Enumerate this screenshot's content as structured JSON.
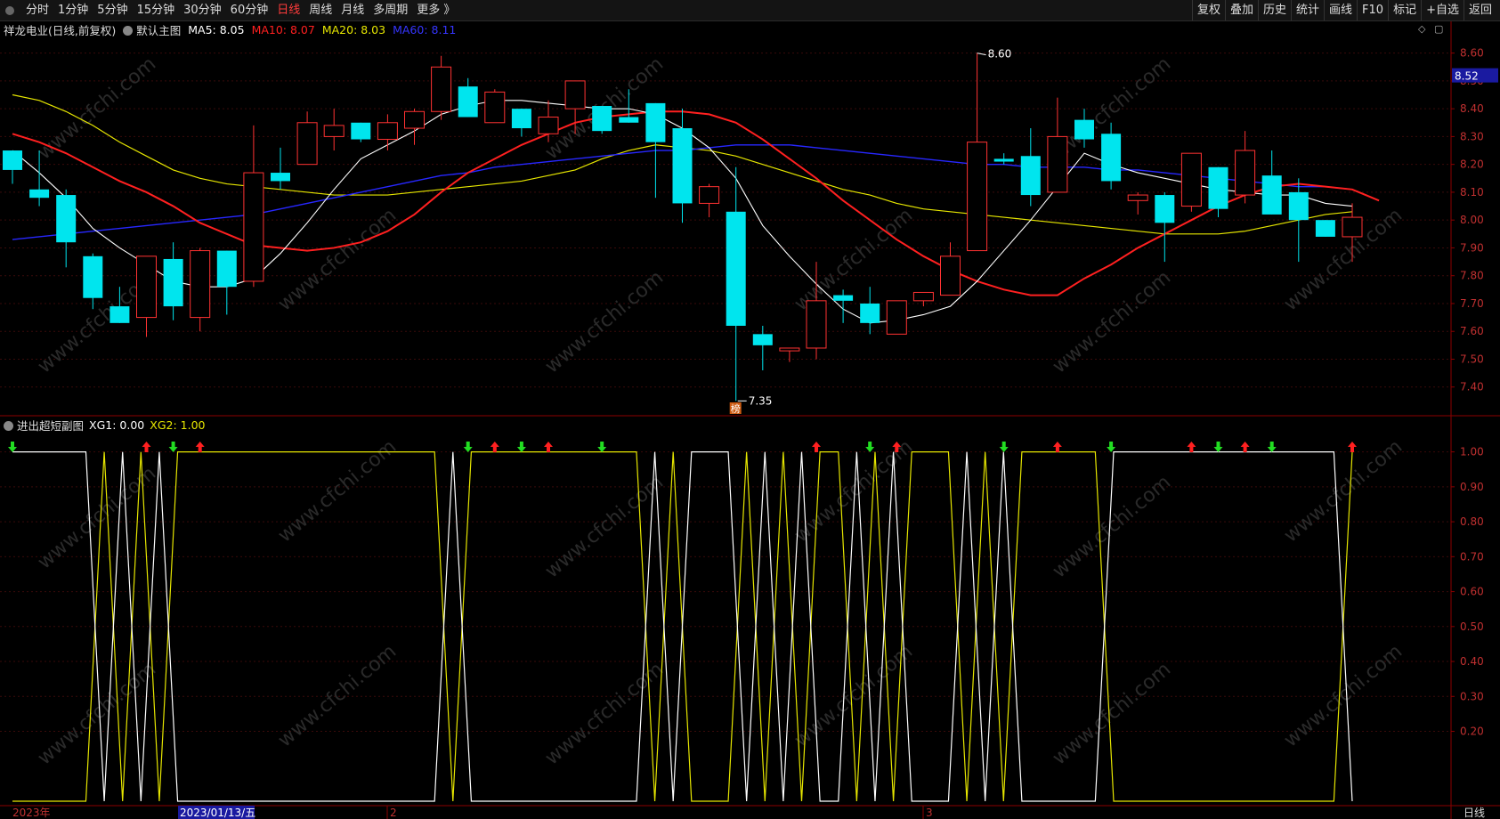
{
  "toolbar": {
    "periods": [
      "分时",
      "1分钟",
      "5分钟",
      "15分钟",
      "30分钟",
      "60分钟",
      "日线",
      "周线",
      "月线",
      "多周期",
      "更多 》"
    ],
    "active_period": "日线",
    "right_buttons": [
      "复权",
      "叠加",
      "历史",
      "统计",
      "画线",
      "F10",
      "标记",
      "+自选",
      "返回"
    ]
  },
  "main_panel": {
    "title": "祥龙电业(日线,前复权)",
    "indicator_name": "默认主图",
    "ma5": {
      "label": "MA5: 8.05",
      "color": "#ffffff"
    },
    "ma10": {
      "label": "MA10: 8.07",
      "color": "#ff2020"
    },
    "ma20": {
      "label": "MA20: 8.03",
      "color": "#e6e600"
    },
    "ma60": {
      "label": "MA60: 8.11",
      "color": "#2727ff"
    },
    "y_ticks": [
      "8.60",
      "8.50",
      "8.40",
      "8.30",
      "8.20",
      "8.10",
      "8.00",
      "7.90",
      "7.80",
      "7.70",
      "7.60",
      "7.50",
      "7.40"
    ],
    "current_price": "8.52",
    "high_label": "8.60",
    "low_label": "7.35",
    "badge": "榜"
  },
  "sub_panel": {
    "title": "进出超短副图",
    "xg1": {
      "label": "XG1: 0.00",
      "color": "#ffffff"
    },
    "xg2": {
      "label": "XG2: 1.00",
      "color": "#e6e600"
    },
    "y_ticks": [
      "1.00",
      "0.90",
      "0.80",
      "0.70",
      "0.60",
      "0.50",
      "0.40",
      "0.30",
      "0.20"
    ]
  },
  "x_axis": {
    "year_label": "2023年",
    "cursor_date": "2023/01/13/五",
    "month_2": "2",
    "month_3": "3",
    "period_tag": "日线"
  },
  "watermark": "www.cfchi.com",
  "chart_data": {
    "type": "candlestick",
    "ohlc": [
      [
        8.25,
        8.25,
        8.13,
        8.18
      ],
      [
        8.11,
        8.25,
        8.05,
        8.08
      ],
      [
        8.09,
        8.11,
        7.83,
        7.92
      ],
      [
        7.87,
        7.88,
        7.68,
        7.72
      ],
      [
        7.69,
        7.76,
        7.63,
        7.63
      ],
      [
        7.65,
        7.87,
        7.58,
        7.87
      ],
      [
        7.86,
        7.92,
        7.64,
        7.69
      ],
      [
        7.65,
        7.9,
        7.6,
        7.89
      ],
      [
        7.89,
        7.89,
        7.66,
        7.76
      ],
      [
        7.78,
        8.34,
        7.76,
        8.17
      ],
      [
        8.17,
        8.26,
        8.11,
        8.14
      ],
      [
        8.2,
        8.39,
        8.2,
        8.35
      ],
      [
        8.3,
        8.4,
        8.25,
        8.34
      ],
      [
        8.35,
        8.35,
        8.28,
        8.29
      ],
      [
        8.29,
        8.38,
        8.25,
        8.35
      ],
      [
        8.33,
        8.4,
        8.27,
        8.39
      ],
      [
        8.39,
        8.59,
        8.36,
        8.55
      ],
      [
        8.48,
        8.51,
        8.37,
        8.37
      ],
      [
        8.35,
        8.47,
        8.35,
        8.46
      ],
      [
        8.4,
        8.4,
        8.3,
        8.33
      ],
      [
        8.31,
        8.43,
        8.28,
        8.37
      ],
      [
        8.4,
        8.5,
        8.31,
        8.5
      ],
      [
        8.41,
        8.41,
        8.31,
        8.32
      ],
      [
        8.37,
        8.47,
        8.35,
        8.35
      ],
      [
        8.42,
        8.42,
        8.08,
        8.28
      ],
      [
        8.33,
        8.4,
        7.99,
        8.06
      ],
      [
        8.06,
        8.13,
        8.01,
        8.12
      ],
      [
        8.03,
        8.19,
        7.35,
        7.62
      ],
      [
        7.59,
        7.62,
        7.46,
        7.55
      ],
      [
        7.53,
        7.53,
        7.49,
        7.54
      ],
      [
        7.54,
        7.85,
        7.5,
        7.71
      ],
      [
        7.73,
        7.75,
        7.63,
        7.71
      ],
      [
        7.7,
        7.76,
        7.59,
        7.63
      ],
      [
        7.59,
        7.71,
        7.59,
        7.71
      ],
      [
        7.71,
        7.74,
        7.69,
        7.74
      ],
      [
        7.73,
        7.92,
        7.73,
        7.87
      ],
      [
        7.89,
        8.6,
        7.89,
        8.28
      ],
      [
        8.22,
        8.24,
        8.2,
        8.21
      ],
      [
        8.23,
        8.33,
        8.05,
        8.09
      ],
      [
        8.1,
        8.44,
        8.1,
        8.3
      ],
      [
        8.36,
        8.4,
        8.26,
        8.29
      ],
      [
        8.31,
        8.35,
        8.11,
        8.14
      ],
      [
        8.07,
        8.1,
        8.02,
        8.09
      ],
      [
        8.09,
        8.1,
        7.85,
        7.99
      ],
      [
        8.05,
        8.24,
        8.03,
        8.24
      ],
      [
        8.19,
        8.19,
        8.01,
        8.04
      ],
      [
        8.09,
        8.32,
        8.06,
        8.25
      ],
      [
        8.16,
        8.25,
        8.02,
        8.02
      ],
      [
        8.1,
        8.15,
        7.85,
        8.0
      ],
      [
        8.0,
        8.0,
        7.94,
        7.94
      ],
      [
        7.94,
        8.06,
        7.85,
        8.01
      ]
    ],
    "ma5_series": [
      8.25,
      8.17,
      8.08,
      7.97,
      7.9,
      7.84,
      7.78,
      7.76,
      7.76,
      7.79,
      7.88,
      7.99,
      8.11,
      8.22,
      8.27,
      8.32,
      8.38,
      8.41,
      8.43,
      8.43,
      8.42,
      8.41,
      8.4,
      8.4,
      8.38,
      8.33,
      8.26,
      8.15,
      7.98,
      7.87,
      7.77,
      7.68,
      7.63,
      7.64,
      7.66,
      7.69,
      7.78,
      7.89,
      8.0,
      8.12,
      8.24,
      8.2,
      8.17,
      8.15,
      8.13,
      8.11,
      8.1,
      8.09,
      8.09,
      8.06,
      8.05
    ],
    "ma10_series": [
      8.31,
      8.28,
      8.24,
      8.19,
      8.14,
      8.1,
      8.05,
      7.99,
      7.95,
      7.91,
      7.9,
      7.89,
      7.9,
      7.92,
      7.96,
      8.02,
      8.1,
      8.17,
      8.22,
      8.27,
      8.31,
      8.35,
      8.37,
      8.38,
      8.39,
      8.39,
      8.38,
      8.35,
      8.29,
      8.22,
      8.15,
      8.07,
      8.0,
      7.93,
      7.87,
      7.82,
      7.78,
      7.75,
      7.73,
      7.73,
      7.79,
      7.84,
      7.9,
      7.95,
      8.0,
      8.05,
      8.09,
      8.12,
      8.13,
      8.12,
      8.11,
      8.07
    ],
    "ma20_series": [
      8.45,
      8.43,
      8.39,
      8.34,
      8.28,
      8.23,
      8.18,
      8.15,
      8.13,
      8.12,
      8.11,
      8.1,
      8.09,
      8.09,
      8.09,
      8.1,
      8.11,
      8.12,
      8.13,
      8.14,
      8.16,
      8.18,
      8.22,
      8.25,
      8.27,
      8.26,
      8.25,
      8.23,
      8.2,
      8.17,
      8.14,
      8.11,
      8.09,
      8.06,
      8.04,
      8.03,
      8.02,
      8.01,
      8.0,
      7.99,
      7.98,
      7.97,
      7.96,
      7.95,
      7.95,
      7.95,
      7.96,
      7.98,
      8.0,
      8.02,
      8.03
    ],
    "ma60_series": [
      7.93,
      7.94,
      7.95,
      7.96,
      7.97,
      7.98,
      7.99,
      8.0,
      8.01,
      8.02,
      8.04,
      8.06,
      8.08,
      8.1,
      8.12,
      8.14,
      8.16,
      8.17,
      8.19,
      8.2,
      8.21,
      8.22,
      8.23,
      8.24,
      8.25,
      8.25,
      8.26,
      8.27,
      8.27,
      8.27,
      8.26,
      8.25,
      8.24,
      8.23,
      8.22,
      8.21,
      8.2,
      8.2,
      8.19,
      8.19,
      8.19,
      8.18,
      8.18,
      8.17,
      8.16,
      8.15,
      8.14,
      8.13,
      8.12,
      8.12,
      8.11
    ],
    "xg2_series": [
      0,
      0,
      0,
      0,
      0,
      1,
      0,
      1,
      0,
      1,
      1,
      1,
      1,
      1,
      1,
      1,
      1,
      1,
      1,
      1,
      1,
      1,
      1,
      1,
      0,
      1,
      1,
      1,
      1,
      1,
      1,
      1,
      1,
      1,
      1,
      0,
      1,
      0,
      0,
      0,
      1,
      0,
      1,
      0,
      1,
      1,
      0,
      1,
      0,
      1,
      1,
      1,
      0,
      1,
      0,
      1,
      1,
      1,
      1,
      1,
      0,
      0,
      0,
      0,
      0,
      0,
      0,
      0,
      0,
      0,
      0,
      0,
      0,
      1
    ],
    "sub_signals": [
      {
        "i": 0,
        "dir": "down"
      },
      {
        "i": 5,
        "dir": "up"
      },
      {
        "i": 6,
        "dir": "down"
      },
      {
        "i": 7,
        "dir": "up"
      },
      {
        "i": 17,
        "dir": "down"
      },
      {
        "i": 18,
        "dir": "up"
      },
      {
        "i": 19,
        "dir": "down"
      },
      {
        "i": 20,
        "dir": "up"
      },
      {
        "i": 22,
        "dir": "down"
      },
      {
        "i": 30,
        "dir": "up"
      },
      {
        "i": 32,
        "dir": "down"
      },
      {
        "i": 33,
        "dir": "up"
      },
      {
        "i": 37,
        "dir": "down"
      },
      {
        "i": 39,
        "dir": "up"
      },
      {
        "i": 41,
        "dir": "down"
      },
      {
        "i": 44,
        "dir": "up"
      },
      {
        "i": 45,
        "dir": "down"
      },
      {
        "i": 46,
        "dir": "up"
      },
      {
        "i": 47,
        "dir": "down"
      },
      {
        "i": 50,
        "dir": "up"
      }
    ],
    "main_ylim": [
      7.3,
      8.65
    ],
    "sub_ylim": [
      0,
      1.05
    ]
  }
}
